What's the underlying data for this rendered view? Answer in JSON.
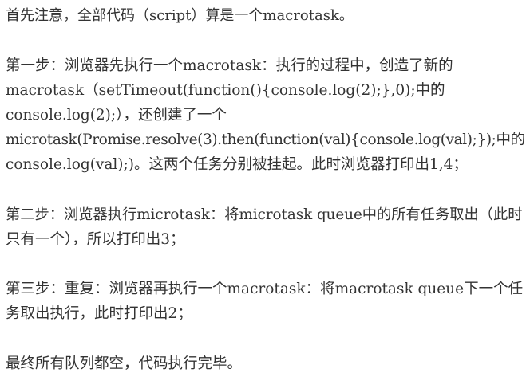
{
  "document": {
    "lines": [
      "首先注意，全部代码（script）算是一个macrotask。",
      "第一步：浏览器先执行一个macrotask：执行的过程中，创造了新的",
      "macrotask（setTimeout(function(){console.log(2);},0);中的",
      "console.log(2);），还创建了一个",
      "microtask(Promise.resolve(3).then(function(val){console.log(val);});中的",
      "console.log(val);)。这两个任务分别被挂起。此时浏览器打印出1,4；",
      "第二步：浏览器执行microtask：将microtask queue中的所有任务取出（此时",
      "只有一个），所以打印出3；",
      "第三步：重复：浏览器再执行一个macrotask：将macrotask queue下一个任",
      "务取出执行，此时打印出2；",
      "最终所有队列都空，代码执行完毕。"
    ]
  }
}
